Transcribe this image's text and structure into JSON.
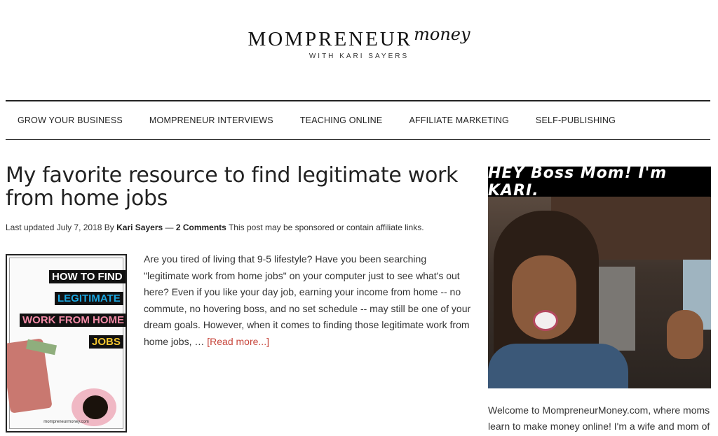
{
  "header": {
    "logo_title": "MOMPRENEUR",
    "logo_script": "money",
    "logo_subtitle": "WITH KARI SAYERS"
  },
  "nav": {
    "items": [
      {
        "label": "GROW YOUR BUSINESS"
      },
      {
        "label": "MOMPRENEUR INTERVIEWS"
      },
      {
        "label": "TEACHING ONLINE"
      },
      {
        "label": "AFFILIATE MARKETING"
      },
      {
        "label": "SELF-PUBLISHING"
      }
    ]
  },
  "article": {
    "title": "My favorite resource to find legitimate work from home jobs",
    "meta_prefix": "Last updated July 7, 2018 By ",
    "author": "Kari Sayers",
    "meta_sep": " — ",
    "comments": "2 Comments",
    "disclaimer": " This post may be sponsored or contain affiliate links.",
    "excerpt": "Are you tired of living that 9-5 lifestyle? Have you been searching \"legitimate work from home jobs\" on your computer just to see what's out here? Even if you like your day job, earning your income from home -- no commute, no hovering boss, and no set schedule -- may still be one of your dream goals. However, when it comes to finding those legitimate work from home jobs, …",
    "read_more": "[Read more...]",
    "image": {
      "line1": "HOW TO FIND",
      "line2": "LEGITIMATE",
      "line3": "WORK FROM HOME",
      "line4": "JOBS",
      "url": "mompreneurmoney.com"
    }
  },
  "sidebar": {
    "banner": "HEY Boss Mom! I'm KARI.",
    "welcome": "Welcome to MompreneurMoney.com, where moms learn to make money online! I'm a wife and mom of"
  }
}
